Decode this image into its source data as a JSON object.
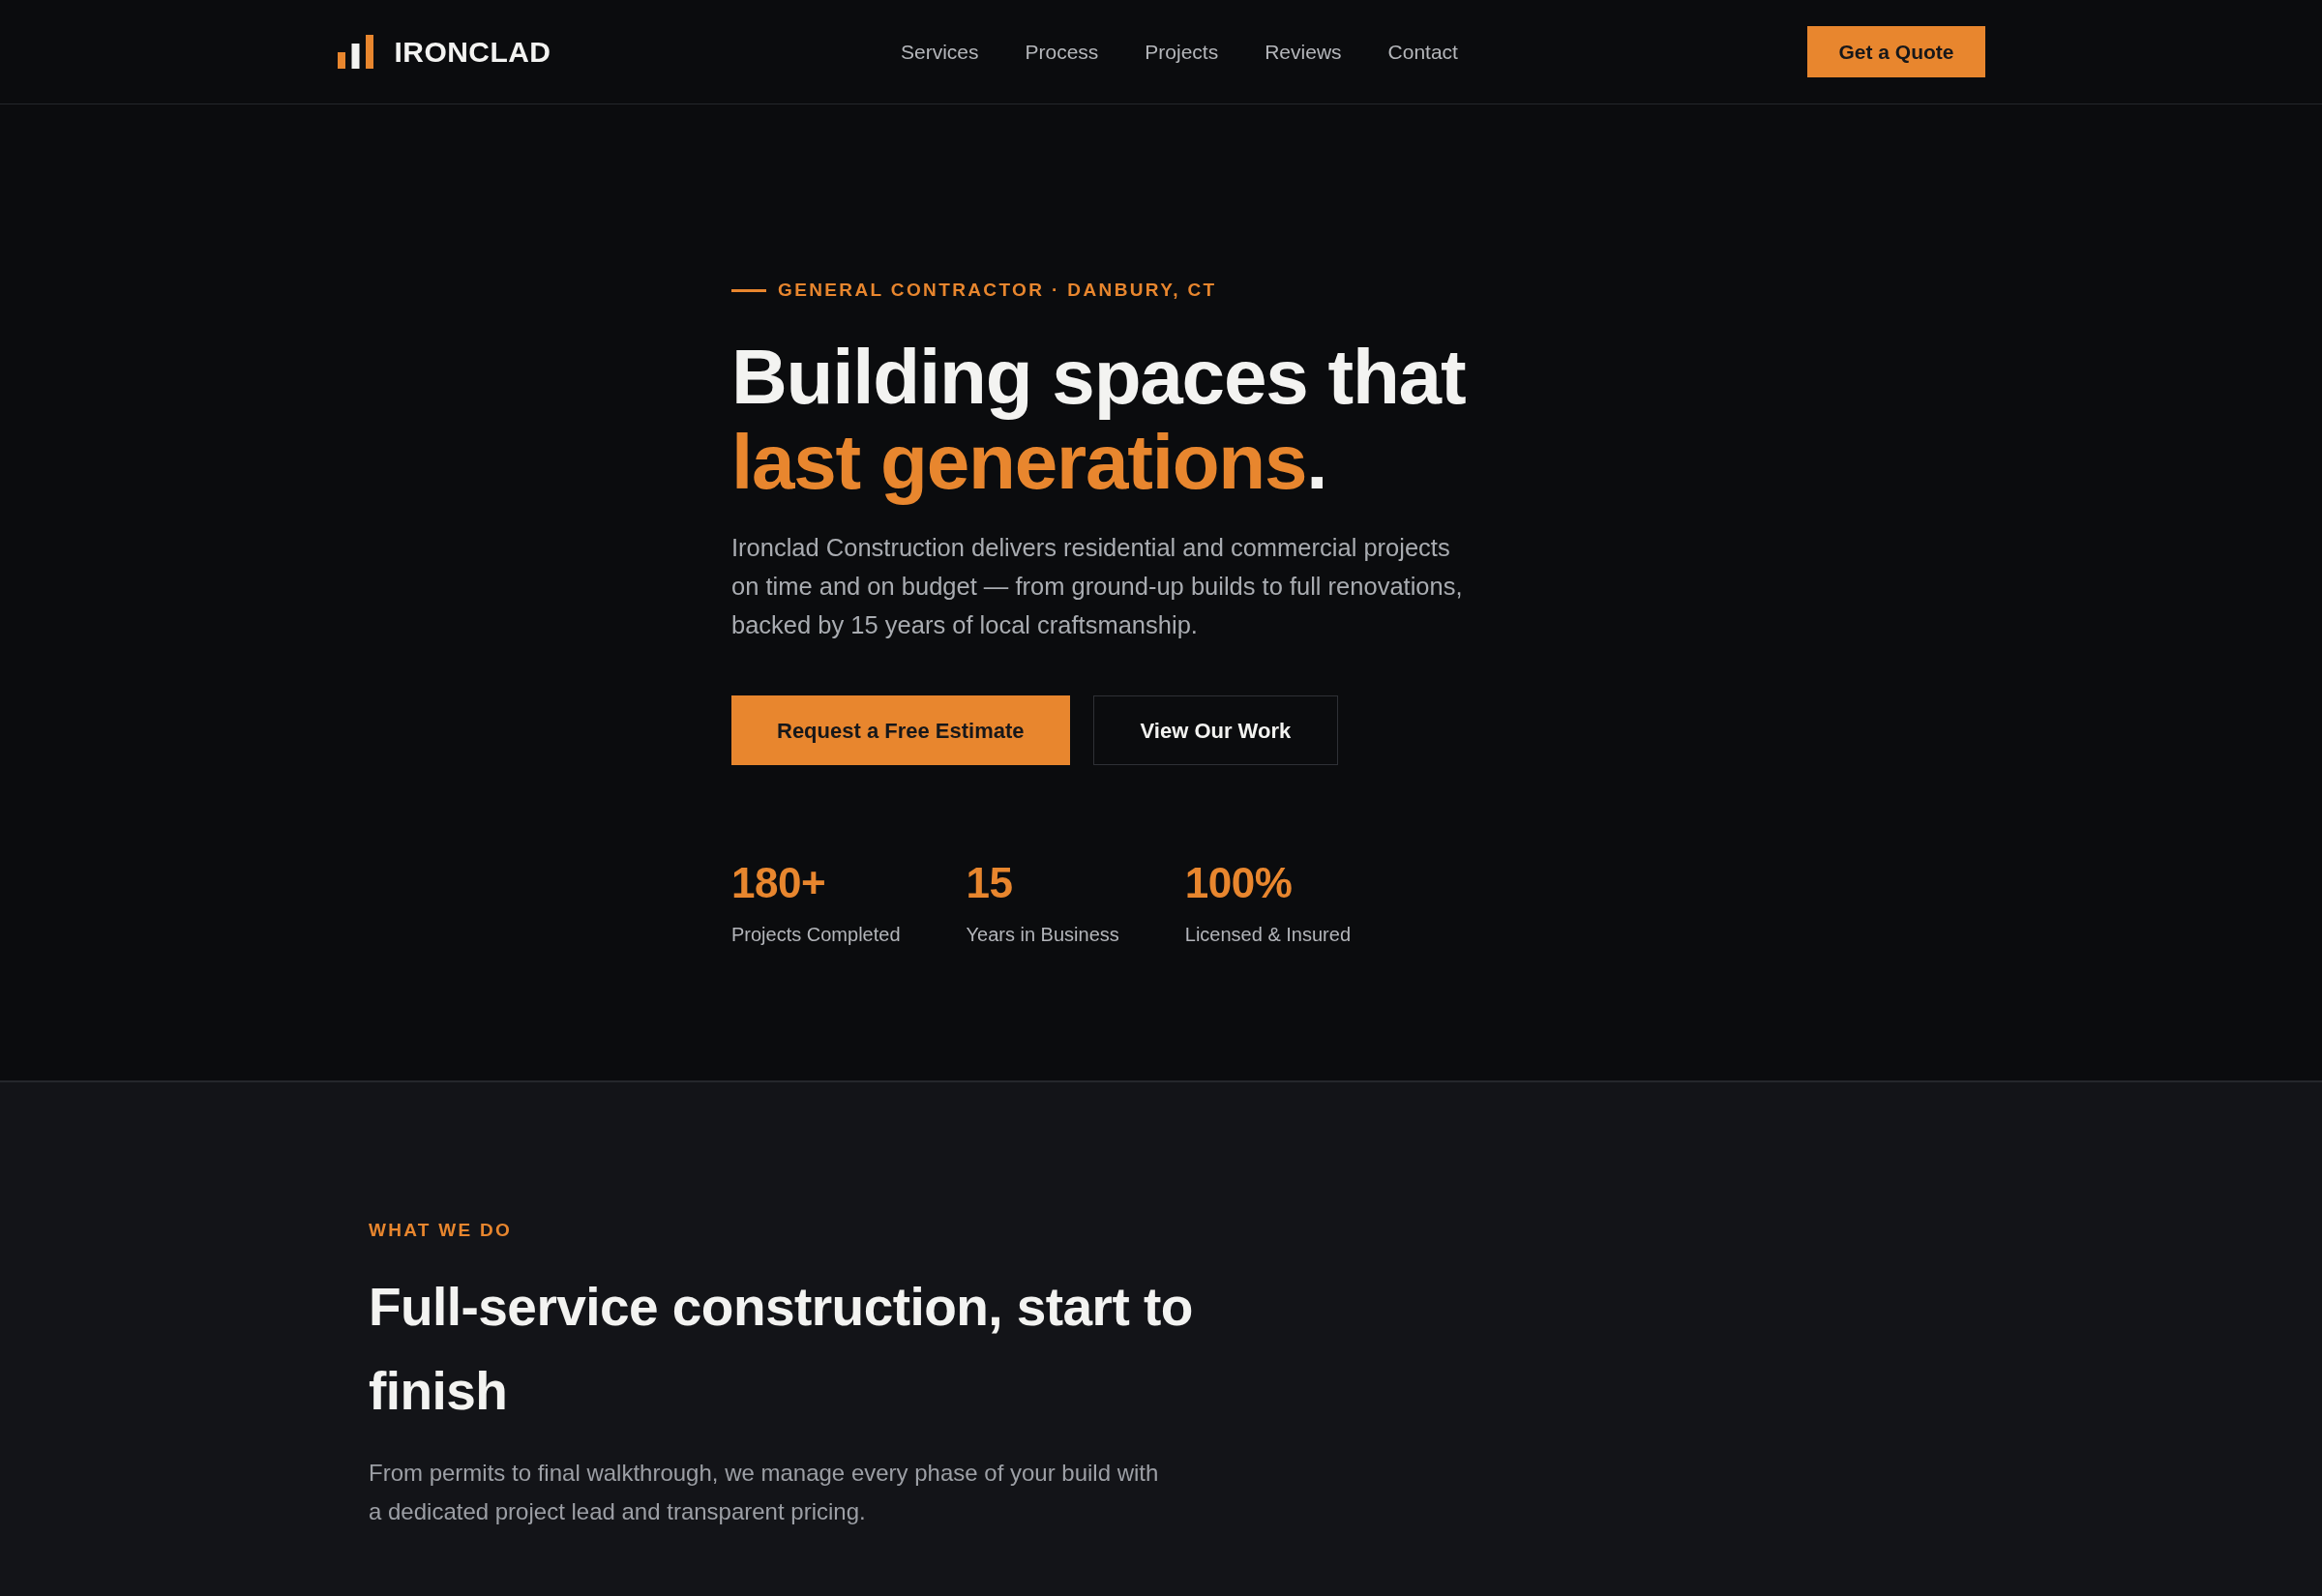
{
  "header": {
    "brand": "IRONCLAD",
    "nav": [
      "Services",
      "Process",
      "Projects",
      "Reviews",
      "Contact"
    ],
    "cta": "Get a Quote"
  },
  "hero": {
    "eyebrow": "GENERAL CONTRACTOR · DANBURY, CT",
    "heading": [
      {
        "text": "Building spaces that ",
        "accent": false
      },
      {
        "text": "last generations",
        "accent": true
      },
      {
        "text": ".",
        "accent": false
      }
    ],
    "description": "Ironclad Construction delivers residential and commercial projects on time and on budget — from ground-up builds to full renovations, backed by 15 years of local craftsmanship.",
    "buttons": [
      {
        "label": "Request a Free Estimate",
        "kind": "primary"
      },
      {
        "label": "View Our Work",
        "kind": "secondary"
      }
    ],
    "stats": [
      {
        "value": "180+",
        "label": "Projects Completed"
      },
      {
        "value": "15",
        "label": "Years in Business"
      },
      {
        "value": "100%",
        "label": "Licensed & Insured"
      }
    ]
  },
  "services": {
    "eyebrow": "WHAT WE DO",
    "heading": "Full-service construction, start to finish",
    "description": "From permits to final walkthrough, we manage every phase of your build with a dedicated project lead and transparent pricing."
  }
}
